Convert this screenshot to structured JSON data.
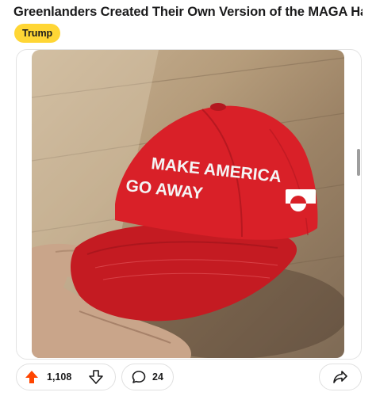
{
  "post": {
    "title": "Greenlanders Created Their Own Version of the MAGA Hat...",
    "flair": "Trump"
  },
  "image": {
    "hat_line1": "MAKE AMERICA",
    "hat_line2": "GO AWAY",
    "hat_color": "#d92028"
  },
  "actions": {
    "upvote_count": "1,108",
    "comment_count": "24",
    "upvote_color": "#ff4500"
  },
  "icons": [
    "upvote-arrow-icon",
    "downvote-arrow-icon",
    "comment-bubble-icon",
    "share-arrow-icon"
  ]
}
